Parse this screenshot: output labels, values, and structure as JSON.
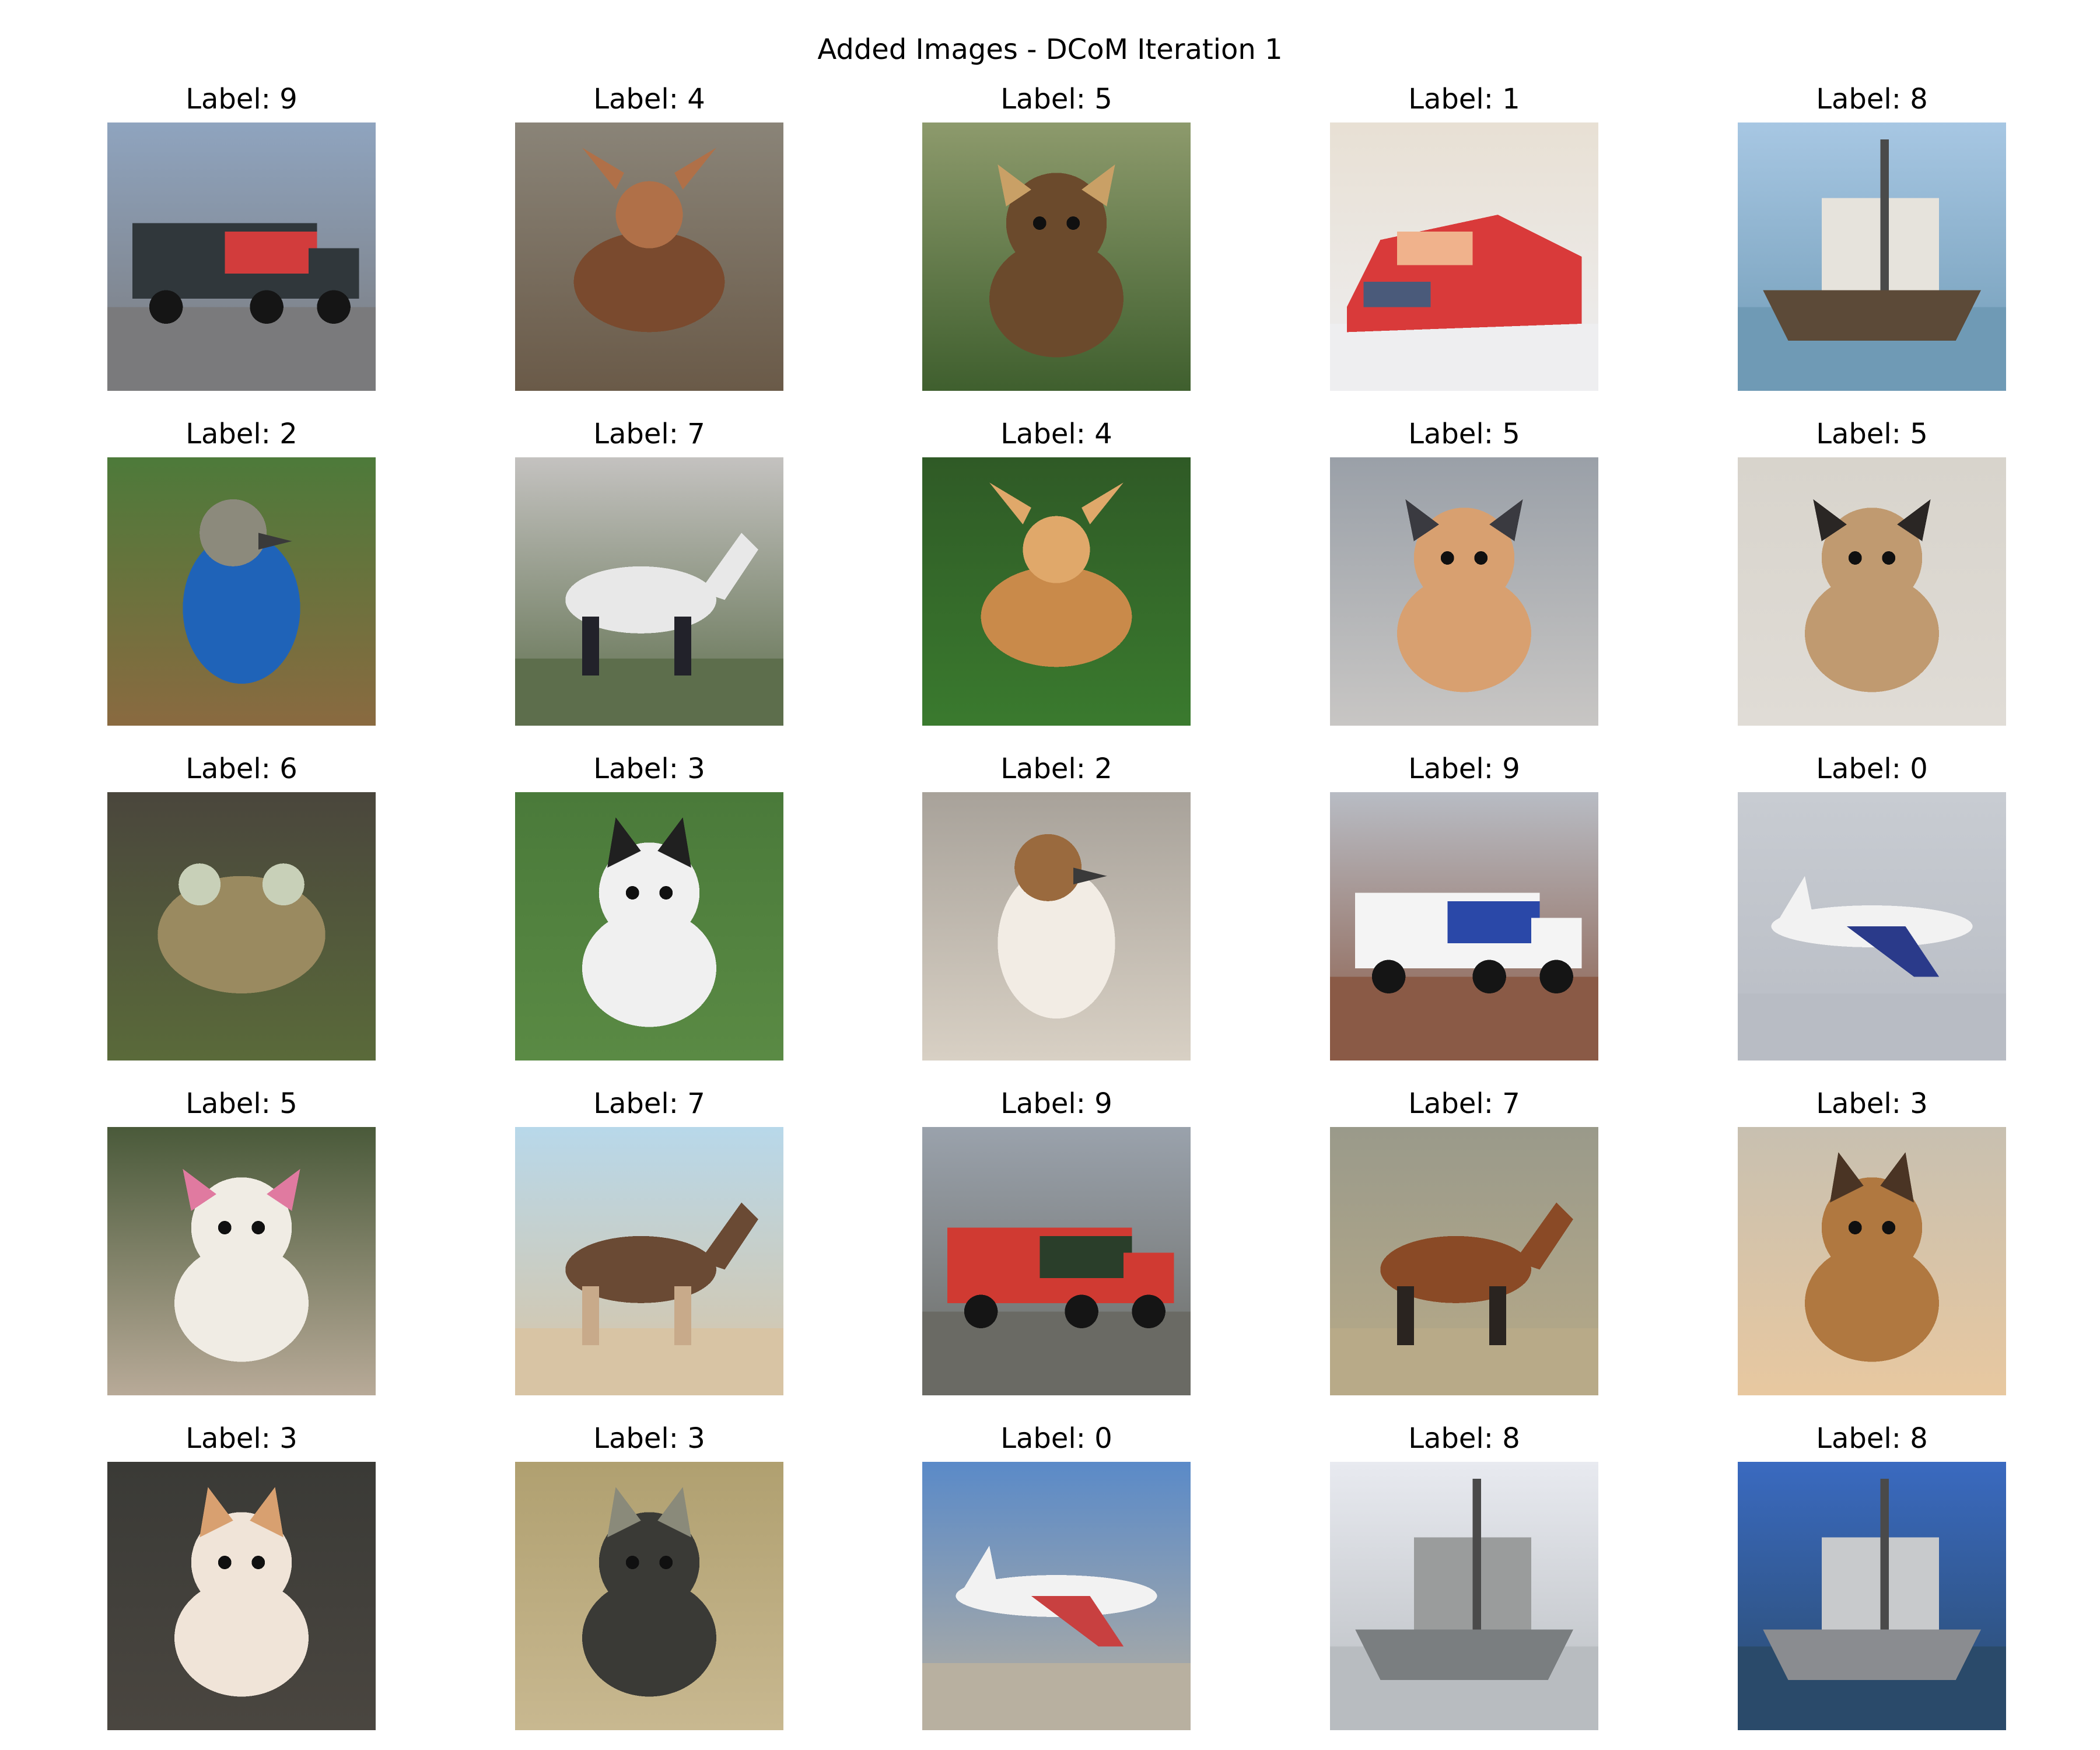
{
  "figure": {
    "title": "Added Images - DCoM Iteration 1"
  },
  "rows": [
    [
      {
        "label": "Label: 9",
        "subject": "truck",
        "colors": {
          "bg": "#8fa4bf",
          "mid": "#30373b",
          "accent": "#d23c3c",
          "ground": "#7a7a7c"
        }
      },
      {
        "label": "Label: 4",
        "subject": "deer",
        "colors": {
          "bg": "#8a8478",
          "mid": "#7a4a2e",
          "accent": "#b07048",
          "ground": "#6a5a48"
        }
      },
      {
        "label": "Label: 5",
        "subject": "dog",
        "colors": {
          "bg": "#8d9a6c",
          "mid": "#6b4a2c",
          "accent": "#c9a066",
          "ground": "#3f5f2e"
        }
      },
      {
        "label": "Label: 1",
        "subject": "car",
        "colors": {
          "bg": "#e8e0d4",
          "mid": "#d93a3a",
          "accent": "#f0b28c",
          "ground": "#eeeef0"
        }
      },
      {
        "label": "Label: 8",
        "subject": "ship",
        "colors": {
          "bg": "#a7c7e3",
          "mid": "#e6e3dc",
          "accent": "#5c4a38",
          "ground": "#6f9ab5"
        }
      }
    ],
    [
      {
        "label": "Label: 2",
        "subject": "bird",
        "colors": {
          "bg": "#4d7a3a",
          "mid": "#1f63b8",
          "accent": "#8c8a7c",
          "ground": "#8a6a40"
        }
      },
      {
        "label": "Label: 7",
        "subject": "horse",
        "colors": {
          "bg": "#c4c2c0",
          "mid": "#e8e8e8",
          "accent": "#22222a",
          "ground": "#5d6e4c"
        }
      },
      {
        "label": "Label: 4",
        "subject": "deer",
        "colors": {
          "bg": "#2f5a26",
          "mid": "#c98a4a",
          "accent": "#e0a86a",
          "ground": "#3a7a2e"
        }
      },
      {
        "label": "Label: 5",
        "subject": "dog",
        "colors": {
          "bg": "#9aa0a8",
          "mid": "#d8a070",
          "accent": "#3a3a40",
          "ground": "#c8c6c4"
        }
      },
      {
        "label": "Label: 5",
        "subject": "dog",
        "colors": {
          "bg": "#d8d4cc",
          "mid": "#c09a70",
          "accent": "#2a2624",
          "ground": "#e0dcd6"
        }
      }
    ],
    [
      {
        "label": "Label: 6",
        "subject": "frog",
        "colors": {
          "bg": "#4a463c",
          "mid": "#9a8a60",
          "accent": "#c8d0b8",
          "ground": "#5a6a3a"
        }
      },
      {
        "label": "Label: 3",
        "subject": "cat",
        "colors": {
          "bg": "#4a7a3a",
          "mid": "#f0f0f0",
          "accent": "#202020",
          "ground": "#5a8a44"
        }
      },
      {
        "label": "Label: 2",
        "subject": "bird",
        "colors": {
          "bg": "#a8a29a",
          "mid": "#f2ece4",
          "accent": "#9a6a3e",
          "ground": "#d8d0c4"
        }
      },
      {
        "label": "Label: 9",
        "subject": "truck",
        "colors": {
          "bg": "#b8bcc4",
          "mid": "#f4f4f4",
          "accent": "#2a48a8",
          "ground": "#8a5a46"
        }
      },
      {
        "label": "Label: 0",
        "subject": "airplane",
        "colors": {
          "bg": "#c8ccd2",
          "mid": "#f2f2f2",
          "accent": "#2a3a8a",
          "ground": "#b8bcc4"
        }
      }
    ],
    [
      {
        "label": "Label: 5",
        "subject": "dog",
        "colors": {
          "bg": "#4a5a3a",
          "mid": "#f0ece4",
          "accent": "#e07aa0",
          "ground": "#b8aa98"
        }
      },
      {
        "label": "Label: 7",
        "subject": "horse",
        "colors": {
          "bg": "#b8d8ea",
          "mid": "#6a4a34",
          "accent": "#c8aa8a",
          "ground": "#d8c4a4"
        }
      },
      {
        "label": "Label: 9",
        "subject": "truck",
        "colors": {
          "bg": "#9aa2ac",
          "mid": "#d03a32",
          "accent": "#2a3e2a",
          "ground": "#6a6a64"
        }
      },
      {
        "label": "Label: 7",
        "subject": "horse",
        "colors": {
          "bg": "#9a9a8a",
          "mid": "#8a4a26",
          "accent": "#2a2420",
          "ground": "#b8aa88"
        }
      },
      {
        "label": "Label: 3",
        "subject": "cat",
        "colors": {
          "bg": "#c8c0b0",
          "mid": "#b07840",
          "accent": "#4a3424",
          "ground": "#e8c8a0"
        }
      }
    ],
    [
      {
        "label": "Label: 3",
        "subject": "cat",
        "colors": {
          "bg": "#3a3a36",
          "mid": "#f0e4d8",
          "accent": "#d8a070",
          "ground": "#4a4640"
        }
      },
      {
        "label": "Label: 3",
        "subject": "cat",
        "colors": {
          "bg": "#b0a070",
          "mid": "#3a3a36",
          "accent": "#8a8a7a",
          "ground": "#c8b890"
        }
      },
      {
        "label": "Label: 0",
        "subject": "airplane",
        "colors": {
          "bg": "#5a8ac8",
          "mid": "#f2f2f2",
          "accent": "#c84040",
          "ground": "#b8b0a0"
        }
      },
      {
        "label": "Label: 8",
        "subject": "ship",
        "colors": {
          "bg": "#e8eaf0",
          "mid": "#9a9c9c",
          "accent": "#7a7e80",
          "ground": "#b8bcc0"
        }
      },
      {
        "label": "Label: 8",
        "subject": "ship",
        "colors": {
          "bg": "#3a6ac0",
          "mid": "#c8cacc",
          "accent": "#8a8c90",
          "ground": "#2a4a6a"
        }
      }
    ]
  ]
}
